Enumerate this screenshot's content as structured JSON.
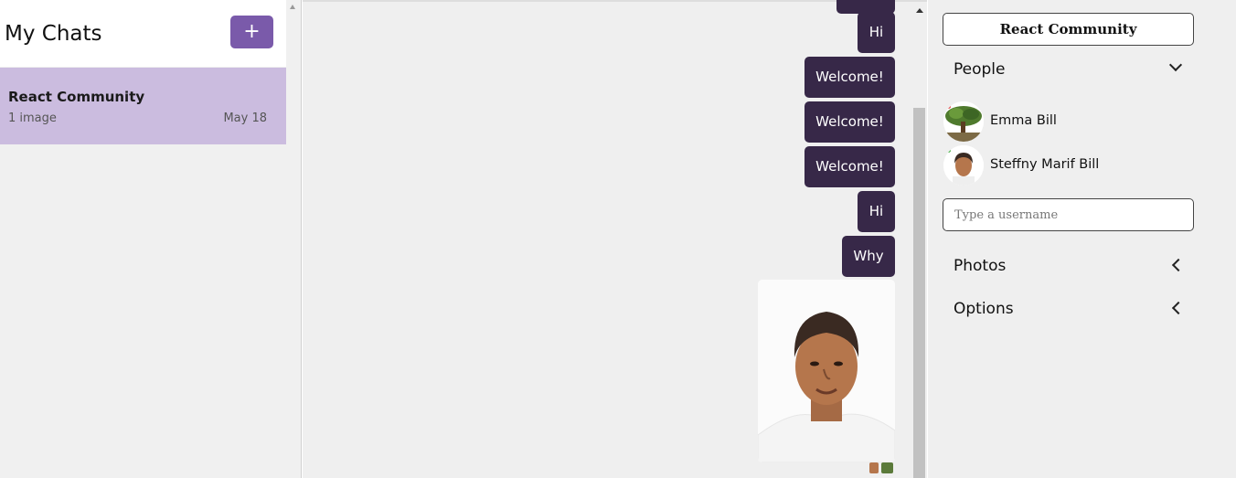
{
  "sidebar": {
    "title": "My Chats",
    "new_chat_label": "+",
    "chats": [
      {
        "title": "React Community",
        "preview": "1 image",
        "date": "May 18"
      }
    ]
  },
  "feed": {
    "messages": [
      {
        "text": "Hi"
      },
      {
        "text": "Welcome!"
      },
      {
        "text": "Welcome!"
      },
      {
        "text": "Welcome!"
      },
      {
        "text": "Hi"
      },
      {
        "text": "Why"
      }
    ],
    "accent": "#372848"
  },
  "settings": {
    "chat_title": "React Community",
    "people_label": "People",
    "people": [
      {
        "name": "Emma Bill",
        "status_color": "#d33"
      },
      {
        "name": "Steffny Marif Bill",
        "status_color": "#3a3"
      }
    ],
    "username_placeholder": "Type a username",
    "photos_label": "Photos",
    "options_label": "Options"
  },
  "colors": {
    "brand": "#7a5aaa",
    "selected_chat": "#cbbcdf"
  }
}
